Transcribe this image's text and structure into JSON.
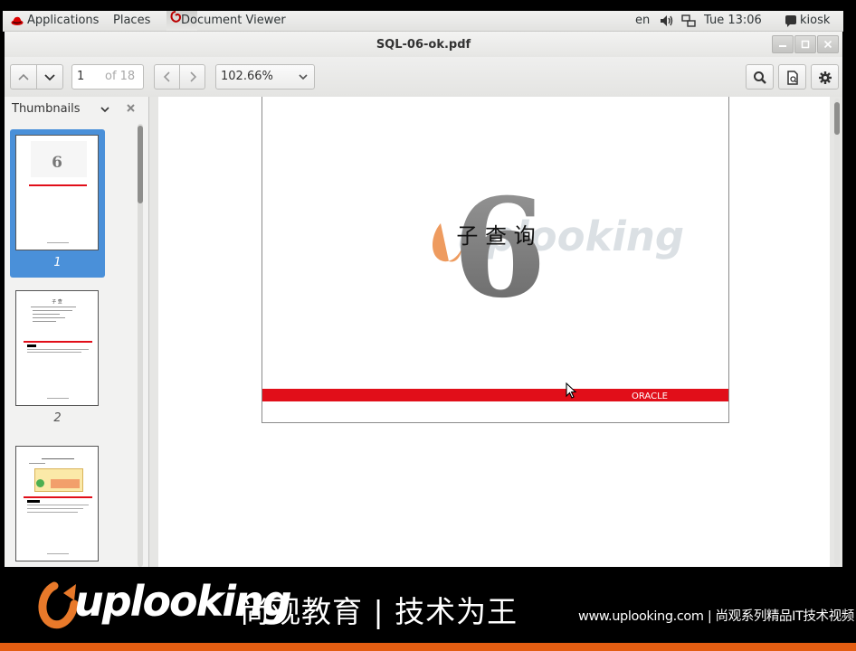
{
  "panel": {
    "applications": "Applications",
    "places": "Places",
    "app_name": "Document Viewer",
    "lang": "en",
    "time": "Tue 13:06",
    "user": "kiosk"
  },
  "window": {
    "title": "SQL-06-ok.pdf"
  },
  "toolbar": {
    "page_number": "1",
    "page_count": "of 18",
    "zoom": "102.66%"
  },
  "sidebar": {
    "header": "Thumbnails",
    "thumbnails": [
      {
        "label": "1",
        "selected": true
      },
      {
        "label": "2",
        "selected": false
      },
      {
        "label": "",
        "selected": false
      }
    ]
  },
  "document": {
    "chapter_number": "6",
    "chapter_title": "子  查  询",
    "watermark": "uplooking",
    "vendor": "ORACLE"
  },
  "thumb_text": {
    "p1_num": "6",
    "p2_heading": "子 查"
  },
  "banner": {
    "logo": "uplooking",
    "brand": "尚观教育 | 技术为王",
    "site": "www.uplooking.com | 尚观系列精品IT技术视频"
  },
  "colors": {
    "selection": "#4a90d9",
    "oracle_red": "#e10e19",
    "logo_orange": "#e8792a",
    "banner_stripe": "#e35d12"
  }
}
